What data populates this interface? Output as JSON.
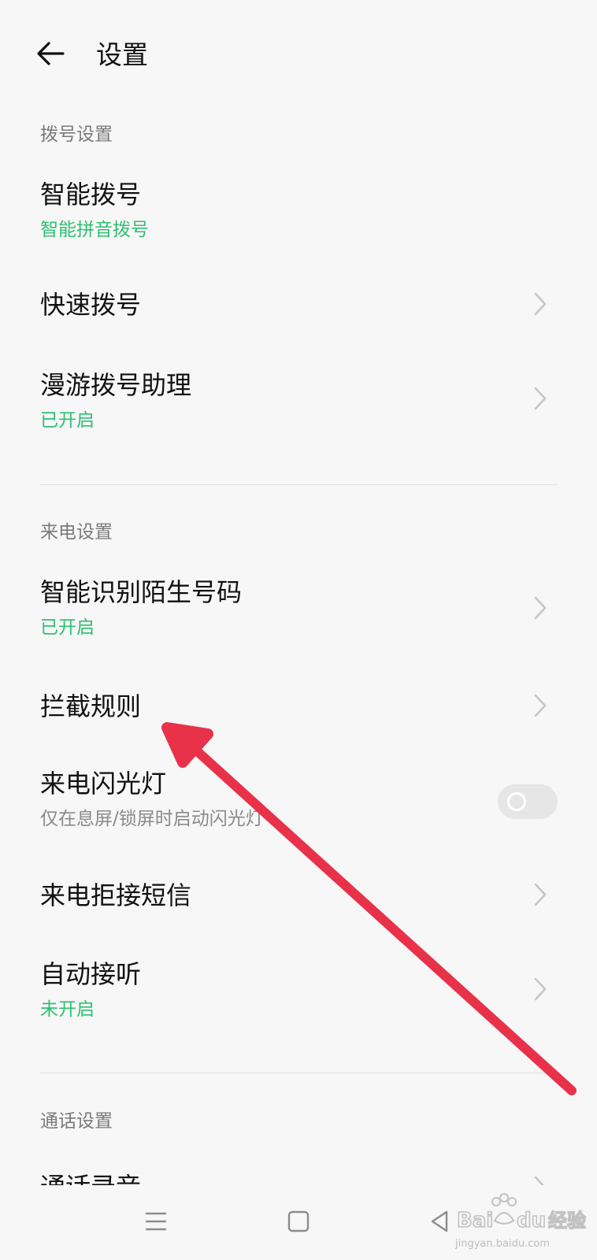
{
  "header": {
    "title": "设置"
  },
  "sections": {
    "dial": {
      "title": "拨号设置",
      "items": [
        {
          "title": "智能拨号",
          "subtitle": "智能拼音拨号"
        },
        {
          "title": "快速拨号"
        },
        {
          "title": "漫游拨号助理",
          "subtitle": "已开启"
        }
      ]
    },
    "incoming": {
      "title": "来电设置",
      "items": [
        {
          "title": "智能识别陌生号码",
          "subtitle": "已开启"
        },
        {
          "title": "拦截规则"
        },
        {
          "title": "来电闪光灯",
          "subtitle": "仅在息屏/锁屏时启动闪光灯",
          "toggle": "off"
        },
        {
          "title": "来电拒接短信"
        },
        {
          "title": "自动接听",
          "subtitle": "未开启"
        }
      ]
    },
    "call": {
      "title": "通话设置",
      "items": [
        {
          "title": "通话录音"
        }
      ]
    }
  },
  "navbar": {
    "icons": [
      "menu-icon",
      "home-icon",
      "back-triangle-icon"
    ]
  },
  "watermark": {
    "text": "jingyan.baidu.com"
  },
  "colors": {
    "accent_green": "#2fbf72",
    "annotation_arrow": "#e8324a",
    "background": "#f7f7f7"
  }
}
